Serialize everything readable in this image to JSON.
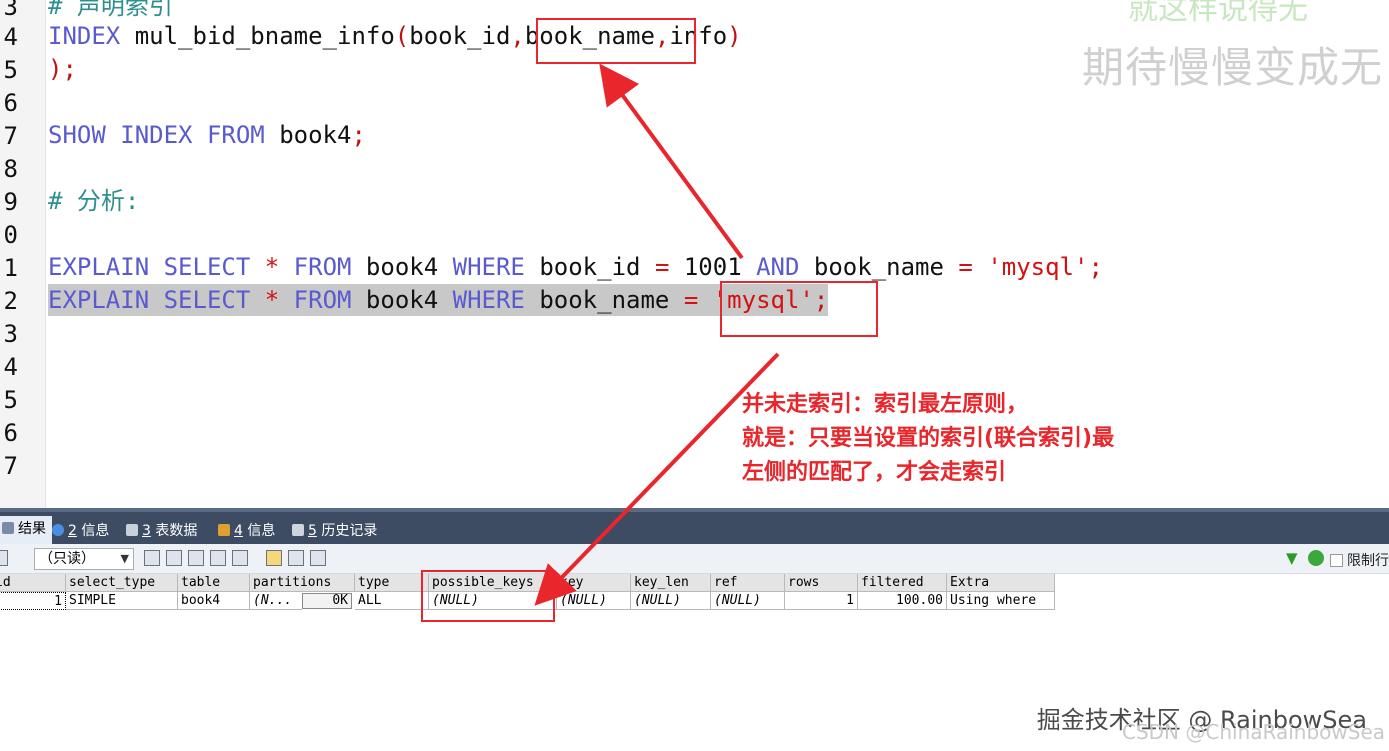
{
  "editor": {
    "line_numbers": [
      "3",
      "4",
      "5",
      "6",
      "7",
      "8",
      "9",
      "0",
      "1",
      "2",
      "3",
      "4",
      "5",
      "6",
      "7"
    ],
    "lines": {
      "l3_comment": "# 声明索引",
      "l4_kw": "INDEX",
      "l4_name": " mul_bid_bname_info",
      "l4_open": "(",
      "l4_arg1": "book_id",
      "l4_c1": ",",
      "l4_arg2": "book_name",
      "l4_c2": ",",
      "l4_arg3": "info",
      "l4_close": ")",
      "l5": ");",
      "l7_kw1": "SHOW",
      "l7_kw2": "INDEX",
      "l7_kw3": "FROM",
      "l7_tbl": "book4",
      "l7_semi": ";",
      "l9_comment": "# 分析:",
      "l11_kw1": "EXPLAIN",
      "l11_kw2": "SELECT",
      "l11_star": "*",
      "l11_kw3": "FROM",
      "l11_tbl": "book4",
      "l11_kw4": "WHERE",
      "l11_col1": "book_id",
      "l11_eq1": "=",
      "l11_num": "1001",
      "l11_kw5": "AND",
      "l11_col2": "book_name",
      "l11_eq2": "=",
      "l11_str": "'mysql'",
      "l11_semi": ";",
      "l12_kw1": "EXPLAIN",
      "l12_kw2": "SELECT",
      "l12_star": "*",
      "l12_kw3": "FROM",
      "l12_tbl": "book4",
      "l12_kw4": "WHERE",
      "l12_col": "book_name",
      "l12_eq": "=",
      "l12_str": "'mysql'",
      "l12_semi": ";"
    },
    "watermark_top": "就这样说得无",
    "watermark_side": "期待慢慢变成无"
  },
  "annotation": {
    "line1": "并未走索引：索引最左原则，",
    "line2": "就是：只要当设置的索引(联合索引)最",
    "line3": "左侧的匹配了，才会走索引"
  },
  "tabs": [
    {
      "num": "",
      "label": "结果"
    },
    {
      "num": "2",
      "label": " 信息"
    },
    {
      "num": "3",
      "label": " 表数据"
    },
    {
      "num": "4",
      "label": " 信息"
    },
    {
      "num": "5",
      "label": " 历史记录"
    }
  ],
  "toolbar": {
    "mode_select": "（只读）",
    "right_label": "限制行"
  },
  "grid": {
    "columns": [
      "id",
      "select_type",
      "table",
      "partitions",
      "type",
      "possible_keys",
      "key",
      "key_len",
      "ref",
      "rows",
      "filtered",
      "Extra"
    ],
    "row": {
      "id": "1",
      "select_type": "SIMPLE",
      "table": "book4",
      "partitions": "(N...",
      "partitions_size": "0K",
      "type": "ALL",
      "possible_keys": "(NULL)",
      "key": "(NULL)",
      "key_len": "(NULL)",
      "ref": "(NULL)",
      "rows": "1",
      "filtered": "100.00",
      "Extra": "Using where"
    }
  },
  "colors": {
    "keyword": "#5a5acf",
    "string": "#d41010",
    "annotation_red": "#e8262b",
    "tabbar": "#3d4b63"
  },
  "footer": {
    "watermark": "掘金技术社区 @ RainbowSea",
    "csdn": "CSDN @ChinaRainbowSea"
  }
}
